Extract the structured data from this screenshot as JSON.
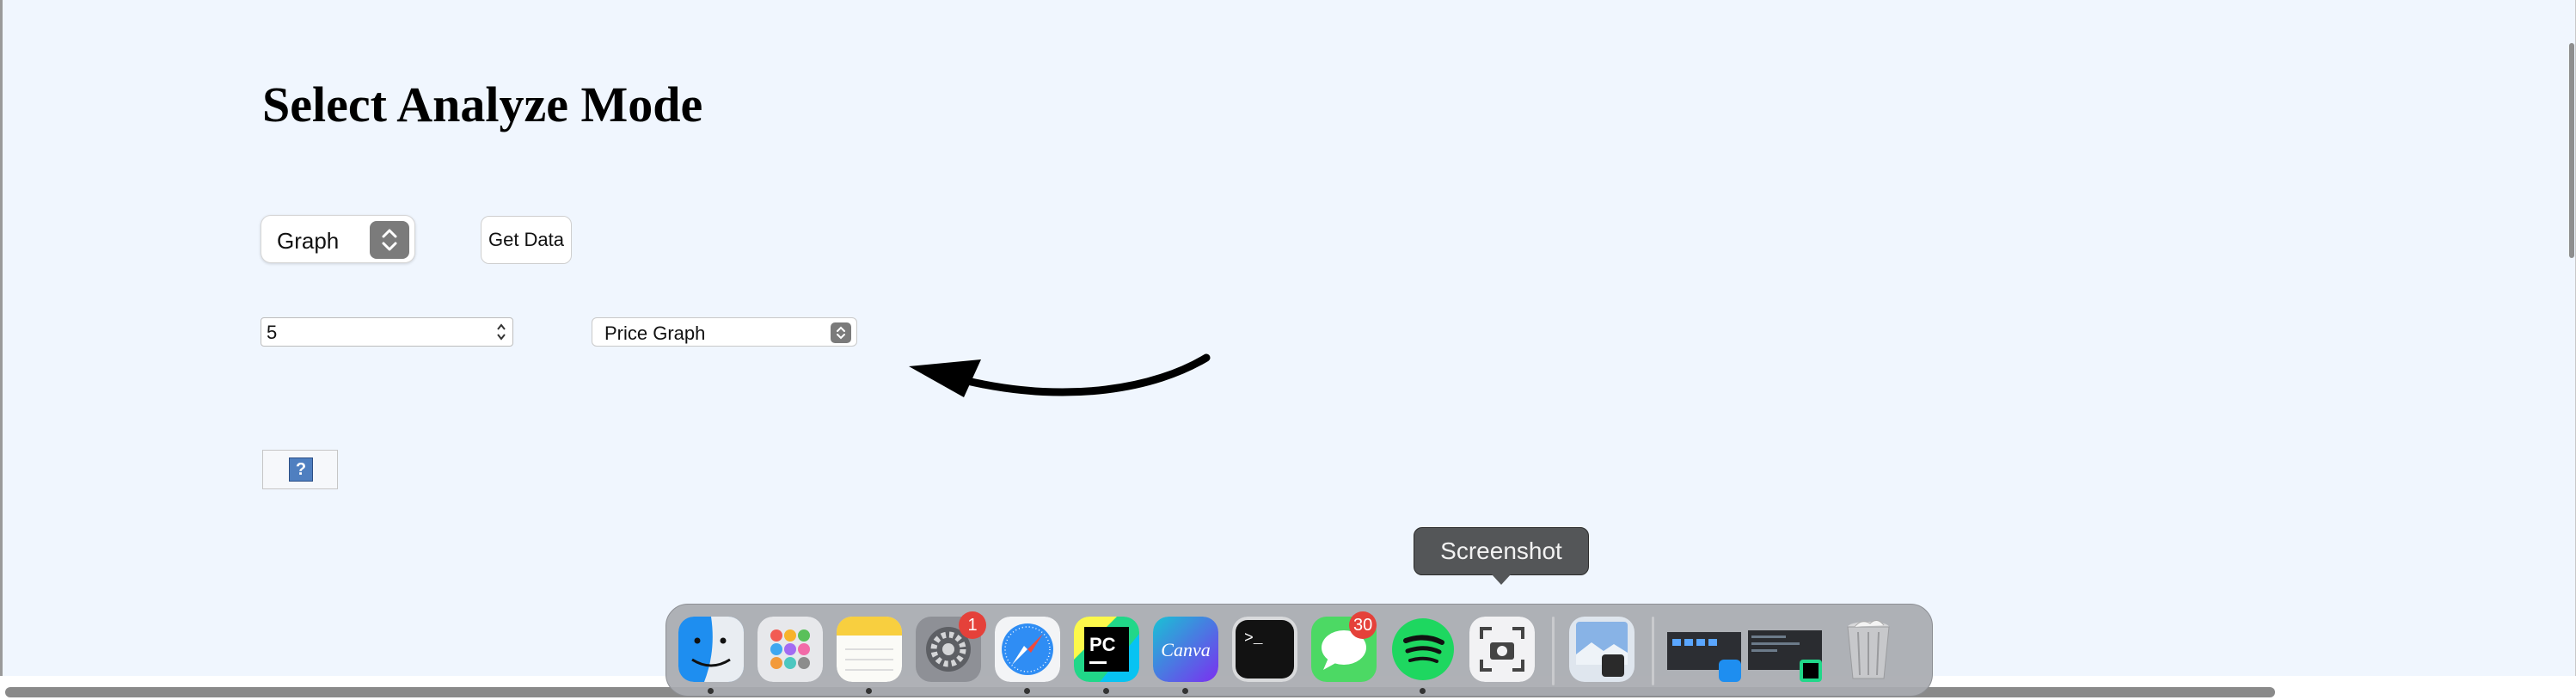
{
  "page": {
    "title": "Select Analyze Mode",
    "mode_select": {
      "value": "Graph"
    },
    "get_data_label": "Get Data",
    "number_input": {
      "value": "5"
    },
    "graph_select": {
      "value": "Price Graph"
    },
    "help_glyph": "?"
  },
  "tooltip": {
    "label": "Screenshot"
  },
  "dock": {
    "items": [
      {
        "name": "finder-icon",
        "running": true
      },
      {
        "name": "launchpad-icon",
        "running": false
      },
      {
        "name": "notes-icon",
        "running": true
      },
      {
        "name": "system-settings-icon",
        "running": false,
        "badge": "1"
      },
      {
        "name": "safari-icon",
        "running": true
      },
      {
        "name": "pycharm-icon",
        "label": "PC",
        "running": true
      },
      {
        "name": "canva-icon",
        "label": "Canva",
        "running": true
      },
      {
        "name": "terminal-icon",
        "label": ">_",
        "running": false
      },
      {
        "name": "messages-icon",
        "running": false,
        "badge": "30"
      },
      {
        "name": "spotify-icon",
        "running": true
      },
      {
        "name": "screenshot-icon",
        "running": false
      },
      {
        "name": "preview-icon",
        "running": false
      },
      {
        "name": "finder-window-thumbnail",
        "running": false
      },
      {
        "name": "pycharm-window-thumbnail",
        "running": false
      },
      {
        "name": "trash-icon",
        "running": false
      }
    ]
  },
  "colors": {
    "page_background": "#f0f6fe",
    "select_arrow_button": "#7b7b7b",
    "badge": "#e5413a",
    "tooltip_background": "#545658"
  }
}
